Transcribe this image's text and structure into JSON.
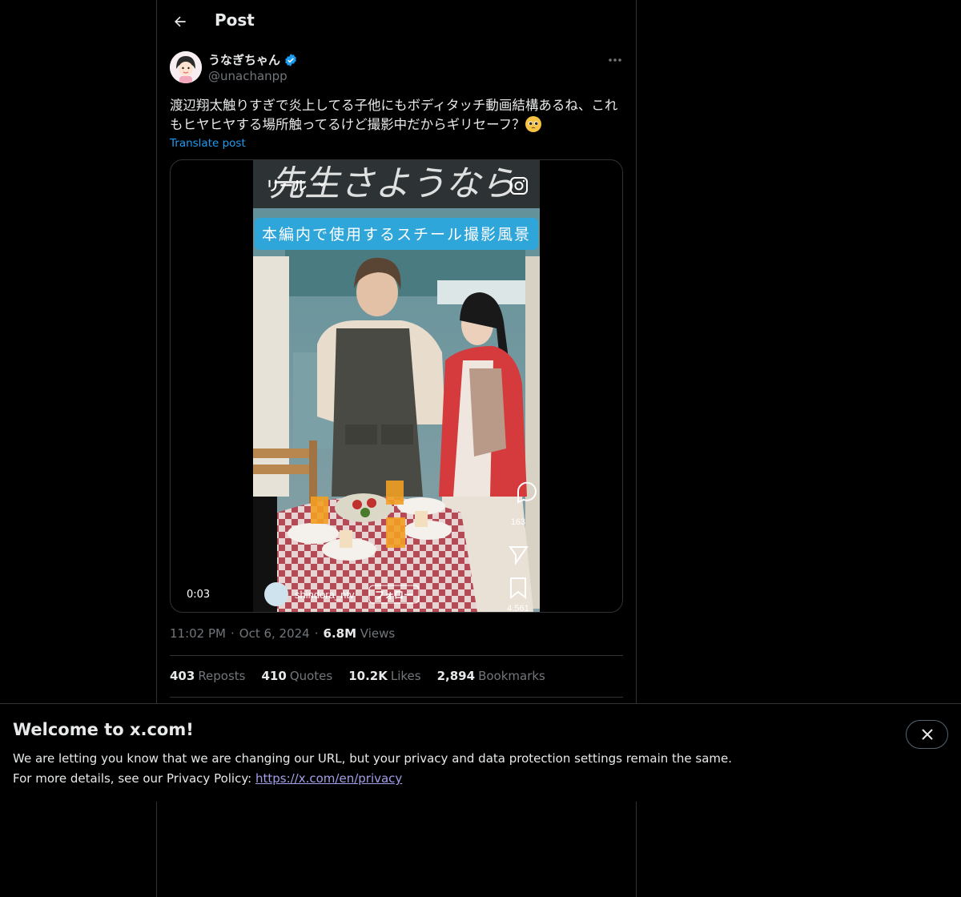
{
  "header": {
    "title": "Post"
  },
  "author": {
    "name": "うなぎちゃん",
    "handle": "@unachanpp",
    "verified": true
  },
  "post": {
    "text": "渡辺翔太触りすぎで炎上してる子他にもボディタッチ動画結構あるね、これもヒヤヒヤする場所触ってるけど撮影中だからギリセーフ？",
    "translate_label": "Translate post"
  },
  "video": {
    "timestamp": "0:03",
    "overlay_title": "先生さようなら",
    "reel_label": "リール",
    "caption": "本編内で使用するスチール撮影風景",
    "account": "shindora_ntv",
    "follow_label": "フォロー",
    "comment_count": "163",
    "bookmark_count": "4,561"
  },
  "meta": {
    "time": "11:02 PM",
    "date": "Oct 6, 2024",
    "views_count": "6.8M",
    "views_label": "Views",
    "sep": "·"
  },
  "stats": [
    {
      "count": "403",
      "label": "Reposts"
    },
    {
      "count": "410",
      "label": "Quotes"
    },
    {
      "count": "10.2K",
      "label": "Likes"
    },
    {
      "count": "2,894",
      "label": "Bookmarks"
    }
  ],
  "banner": {
    "title": "Welcome to x.com!",
    "line1": "We are letting you know that we are changing our URL, but your privacy and data protection settings remain the same.",
    "line2": "For more details, see our Privacy Policy:",
    "link": "https://x.com/en/privacy"
  },
  "colors": {
    "accent": "#1d9bf0",
    "background": "#000000",
    "text": "#e7e9ea",
    "muted": "#71767b",
    "border": "#2f3336"
  }
}
